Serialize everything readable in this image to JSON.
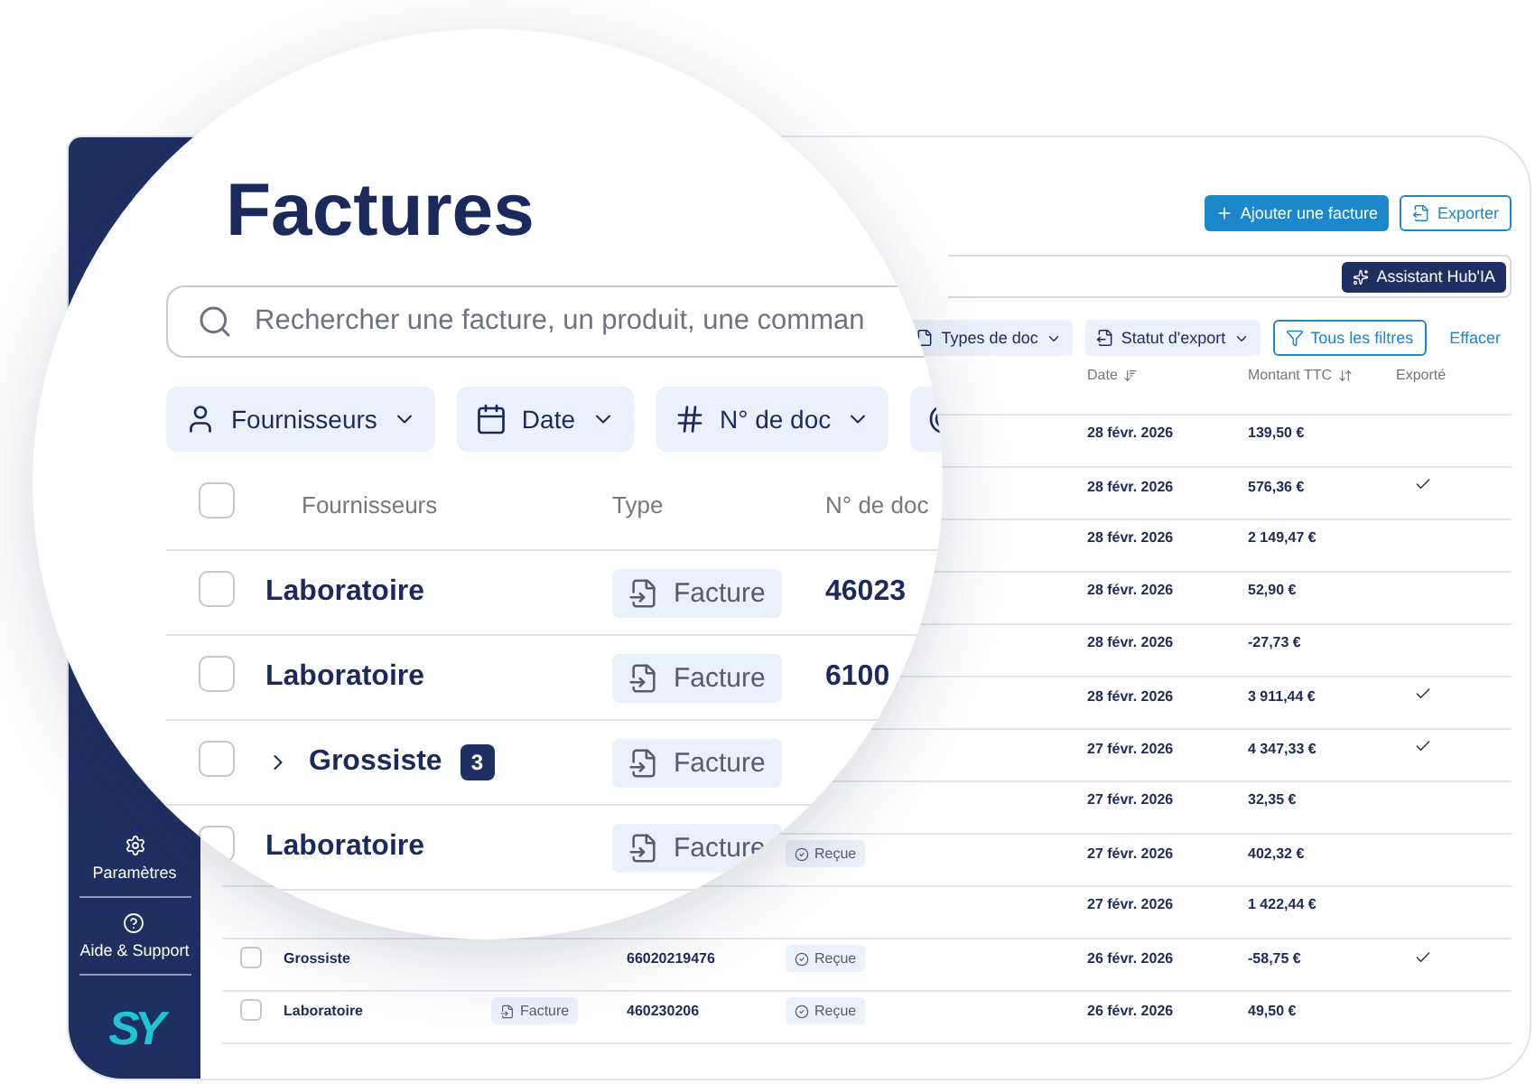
{
  "sidebar": {
    "items": [
      {
        "label": "Paramètres"
      },
      {
        "label": "Aide & Support"
      }
    ],
    "logo": "SY"
  },
  "header": {
    "buttons": [
      {
        "label": "Ajouter une facture",
        "kind": "primary"
      },
      {
        "label": "Exporter",
        "kind": "outline"
      }
    ]
  },
  "assistant": {
    "label": "Assistant Hub'IA"
  },
  "filters": [
    {
      "label": "Types de doc",
      "kind": "chip"
    },
    {
      "label": "Statut d'export",
      "kind": "chip"
    },
    {
      "label": "Tous les filtres",
      "kind": "outline"
    },
    {
      "label": "Effacer",
      "kind": "link"
    }
  ],
  "table": {
    "columns": [
      "Date",
      "Montant TTC",
      "Exporté"
    ],
    "rows": [
      {
        "date": "28 févr. 2026",
        "amount": "139,50 €",
        "exported": false
      },
      {
        "date": "28 févr. 2026",
        "amount": "576,36 €",
        "exported": true
      },
      {
        "date": "28 févr. 2026",
        "amount": "2 149,47 €",
        "exported": false
      },
      {
        "date": "28 févr. 2026",
        "amount": "52,90 €",
        "exported": false
      },
      {
        "date": "28 févr. 2026",
        "amount": "-27,73 €",
        "exported": false
      },
      {
        "date": "28 févr. 2026",
        "amount": "3 911,44 €",
        "exported": true
      },
      {
        "date": "27 févr. 2026",
        "amount": "4 347,33 €",
        "exported": true
      },
      {
        "date": "27 févr. 2026",
        "amount": "32,35 €",
        "exported": false
      },
      {
        "date": "27 févr. 2026",
        "amount": "402,32 €",
        "exported": false,
        "status": "Reçue"
      },
      {
        "date": "27 févr. 2026",
        "amount": "1 422,44 €",
        "exported": false
      },
      {
        "date": "26 févr. 2026",
        "amount": "-58,75 €",
        "exported": true,
        "checked": false,
        "supplier": "Grossiste",
        "doc_no": "66020219476",
        "status": "Reçue"
      },
      {
        "date": "26 févr. 2026",
        "amount": "49,50 €",
        "exported": false,
        "checked": false,
        "supplier": "Laboratoire",
        "type": "Facture",
        "doc_no": "460230206",
        "status": "Reçue"
      }
    ]
  },
  "magnifier": {
    "title": "Factures",
    "search": {
      "placeholder": "Rechercher une facture, un produit, une comman"
    },
    "filters": [
      {
        "label": "Fournisseurs"
      },
      {
        "label": "Date"
      },
      {
        "label": "N° de doc"
      },
      {
        "kind": "icon"
      }
    ],
    "header_checked": false,
    "columns": [
      "Fournisseurs",
      "Type",
      "N° de doc"
    ],
    "rows": [
      {
        "supplier": "Laboratoire",
        "type": "Facture",
        "doc_no": "46023",
        "checked": false
      },
      {
        "supplier": "Laboratoire",
        "type": "Facture",
        "doc_no": "6100",
        "checked": false
      },
      {
        "supplier": "Grossiste",
        "count": "3",
        "expanded": false,
        "type": "Facture",
        "checked": false
      },
      {
        "supplier": "Laboratoire",
        "type": "Facture",
        "checked": false
      }
    ]
  }
}
